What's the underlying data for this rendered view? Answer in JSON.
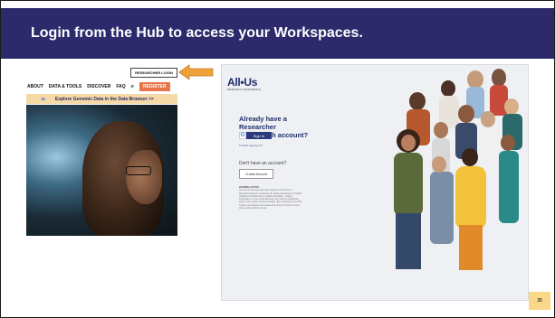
{
  "slide": {
    "title": "Login from the Hub to access your Workspaces.",
    "page_number": "35"
  },
  "hub_screenshot": {
    "login_button": "RESEARCHER LOGIN",
    "nav": {
      "about": "ABOUT",
      "data_tools": "DATA & TOOLS",
      "discover": "DISCOVER",
      "faq": "FAQ",
      "register": "REGISTER"
    },
    "banner": "Explore Genomic Data in the Data Browser >>"
  },
  "workbench_screenshot": {
    "logo": "All•Us",
    "logo_sub": "RESEARCH WORKBENCH",
    "signin_title": "Already have a Researcher Workbench account?",
    "google_button": "Sign In",
    "trouble_link": "Trouble Signing In?",
    "no_account": "Don't have an account?",
    "create_button": "Create Account",
    "warning_title": "WARNING NOTICE",
    "warning_text": "You are accessing a web site created by the All of Us Research Program, funded by the National Institutes of Health. Unauthorized attempts to upload information, change information, or use of this web site may result in disciplinary action, civil, and/or criminal penalties. By continuing to use this system you indicate your awareness of and consent to these terms and conditions of use."
  },
  "colors": {
    "title_bar": "#2c2a6b",
    "arrow": "#f0a23a",
    "register": "#e8754a",
    "banner": "#f5d9a6",
    "page_badge": "#f9d989",
    "logo": "#1f2f6b"
  }
}
